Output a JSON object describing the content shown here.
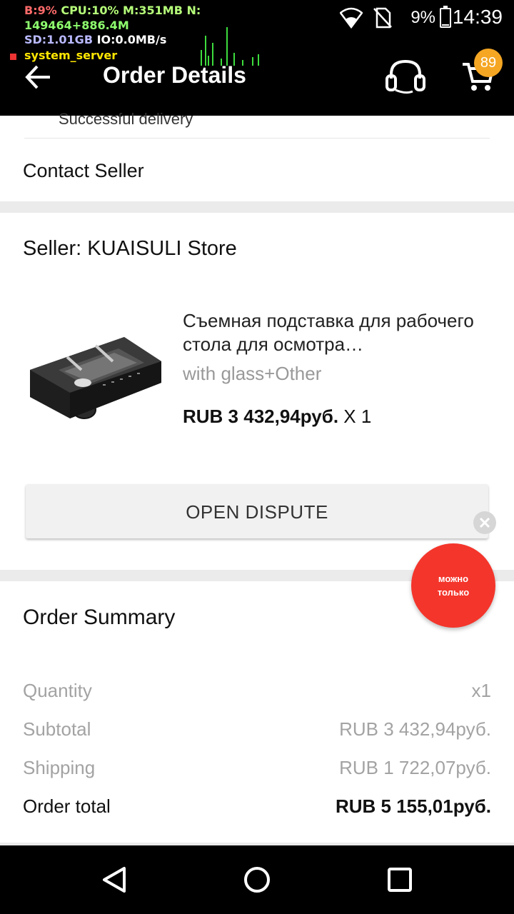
{
  "status_bar": {
    "battery_percent": "9%",
    "battery_level": 0.09,
    "time": "14:39",
    "icons": [
      "wifi-icon",
      "no-sim-icon",
      "battery-icon"
    ]
  },
  "debug_overlay": {
    "cpu_line_a": "B:9% ",
    "cpu_line_b": "CPU:10% M:351MB N:",
    "net_line": "149464+886.4M",
    "sd_label": "SD:1.01GB",
    "io_label": " IO:0.0MB/s",
    "process": "system_server"
  },
  "app_bar": {
    "title": "Order Details",
    "cart_count": "89",
    "icons": [
      "back-arrow-icon",
      "headset-icon",
      "cart-icon"
    ]
  },
  "tracking": {
    "previous_step": "Successful delivery",
    "contact_label": "Contact Seller"
  },
  "seller_card": {
    "seller_label": "Seller: KUAISULI Store",
    "product_name": "Съемная подставка для рабочего стола для осмотра…",
    "variant": "with glass+Other",
    "price": "RUB 3 432,94руб.",
    "quantity": " X 1",
    "dispute_button": "OPEN DISPUTE"
  },
  "promo": {
    "line1": "можно",
    "line2": "только"
  },
  "summary": {
    "heading": "Order Summary",
    "rows": [
      {
        "label": "Quantity",
        "value": "x1"
      },
      {
        "label": "Subtotal",
        "value": "RUB 3 432,94руб."
      },
      {
        "label": "Shipping",
        "value": "RUB 1 722,07руб."
      },
      {
        "label": "Order total",
        "value": "RUB 5 155,01руб."
      }
    ]
  },
  "nav_bar": {
    "icons": [
      "nav-back-icon",
      "nav-home-icon",
      "nav-recents-icon"
    ]
  }
}
